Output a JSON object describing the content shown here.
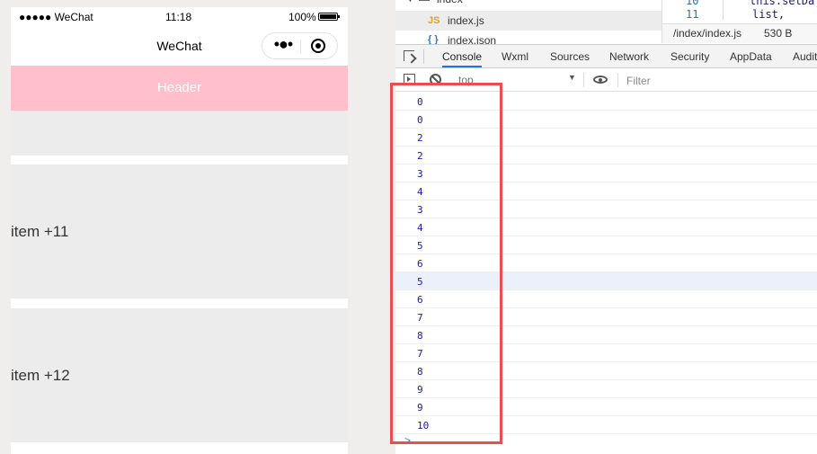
{
  "simulator": {
    "status_bar": {
      "carrier": "●●●●● WeChat",
      "time": "11:18",
      "battery": "100%"
    },
    "nav_title": "WeChat",
    "header": "Header",
    "items": [
      {
        "label": "item +11"
      },
      {
        "label": "item +12"
      }
    ]
  },
  "devtools": {
    "files": [
      {
        "name": "index",
        "type": "folder"
      },
      {
        "name": "index.js",
        "type": "js",
        "icon": "JS"
      },
      {
        "name": "index.json",
        "type": "json",
        "icon": "{ }"
      }
    ],
    "code": {
      "lines": [
        {
          "num": "10",
          "text": "this.setDa"
        },
        {
          "num": "11",
          "text": "list,"
        }
      ]
    },
    "file_path": "/index/index.js",
    "file_size": "530 B",
    "tabs": [
      {
        "label": "Console",
        "active": true
      },
      {
        "label": "Wxml"
      },
      {
        "label": "Sources"
      },
      {
        "label": "Network"
      },
      {
        "label": "Security"
      },
      {
        "label": "AppData"
      },
      {
        "label": "Audits"
      }
    ],
    "context": "top",
    "filter_placeholder": "Filter",
    "console_lines": [
      "0",
      "0",
      "2",
      "2",
      "3",
      "4",
      "3",
      "4",
      "5",
      "6",
      "5",
      "6",
      "7",
      "8",
      "7",
      "8",
      "9",
      "9",
      "10"
    ],
    "highlighted_line_index": 10,
    "prompt": ">"
  },
  "colors": {
    "header_bg": "#ffc0cb",
    "active_tab": "#1a73e8",
    "highlight_box": "#e85050",
    "console_text": "#1a1aa6"
  }
}
